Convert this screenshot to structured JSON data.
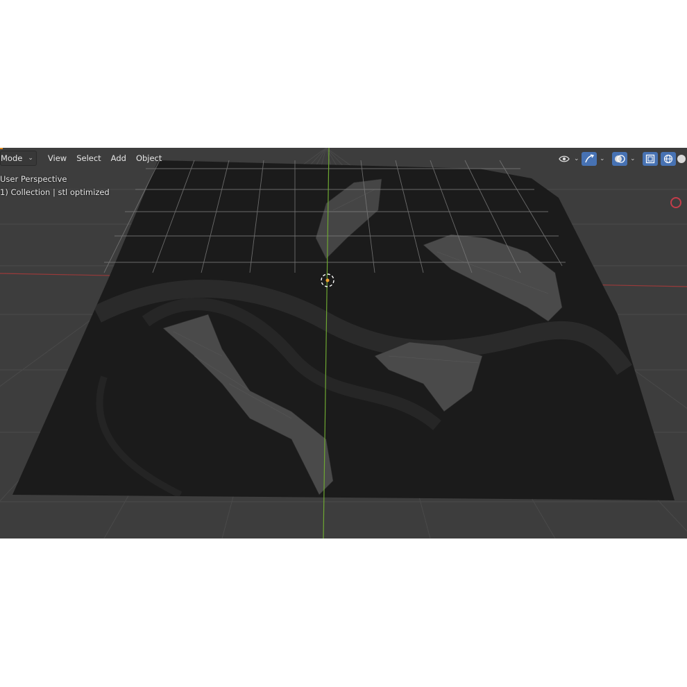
{
  "header": {
    "mode_label": "Mode",
    "menus": [
      "View",
      "Select",
      "Add",
      "Object"
    ]
  },
  "overlay": {
    "perspective": "User Perspective",
    "collection": "1) Collection | stl optimized"
  },
  "icons": {
    "visibility": "eye-icon",
    "gizmo": "gizmo-arrow-icon",
    "overlay": "overlay-circles-icon",
    "xray": "xray-toggle-icon",
    "wireframe_shading": "wireframe-sphere-icon",
    "solid_shading": "solid-sphere-icon",
    "record": "record-icon"
  },
  "colors": {
    "viewport_bg": "#3d3d3d",
    "mesh": "#1b1b1b",
    "grid": "#4a4a4a",
    "x_axis": "#9b3a3a",
    "y_axis": "#6ea832",
    "accent": "#4772b3",
    "origin": "#f0a030"
  }
}
